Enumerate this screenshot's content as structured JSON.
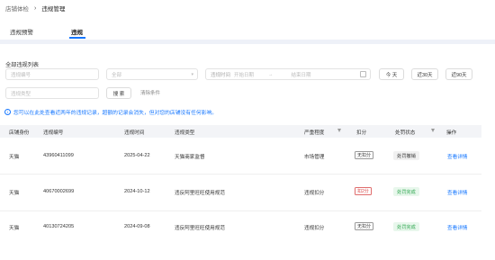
{
  "breadcrumb": {
    "parent": "店铺体检",
    "separator": "›",
    "current": "违规管理"
  },
  "tabs": [
    {
      "label": "违规预警",
      "active": false
    },
    {
      "label": "违规",
      "active": true
    }
  ],
  "filters": {
    "section_title": "全部违规列表",
    "code_placeholder": "违规编号",
    "level_placeholder": "全部",
    "date_label": "违规时间",
    "date_start": "开始日期",
    "date_sep": "→",
    "date_end": "结束日期",
    "type_placeholder": "违规类型",
    "today": "今 天",
    "last30": "近30天",
    "last90": "近90天",
    "search": "搜 索",
    "clear": "清除条件"
  },
  "notice": "您可以在此处查看近两年的违规记录，超额的记录会消失，但对您的店铺没有任何影响。",
  "table": {
    "headers": [
      "店铺身份",
      "违规编号",
      "违规时间",
      "违规类型",
      "严重程度",
      "扣分",
      "处罚状态",
      "操作"
    ],
    "rows": [
      {
        "store": "天猫",
        "code": "43960411099",
        "time": "2025-04-22",
        "type": "天猫商家监督",
        "severity": "市场管理",
        "points": "无扣分",
        "points_style": "gray",
        "status": "处罚撤销",
        "status_style": "gray",
        "action": "查看详情"
      },
      {
        "store": "天猫",
        "code": "40670002699",
        "time": "2024-10-12",
        "type": "违反阿里旺旺使用规范",
        "severity": "违规扣分",
        "points": "扣2分",
        "points_style": "red",
        "status": "处罚完成",
        "status_style": "green",
        "action": "查看详情"
      },
      {
        "store": "天猫",
        "code": "40130724205",
        "time": "2024-09-08",
        "type": "违反阿里旺旺使用规范",
        "severity": "违规扣分",
        "points": "无扣分",
        "points_style": "gray",
        "status": "处罚完成",
        "status_style": "green",
        "action": "查看详情"
      }
    ]
  },
  "colors": {
    "accent": "#1677ff",
    "success": "#2ea64f",
    "danger": "#d94a4a"
  }
}
